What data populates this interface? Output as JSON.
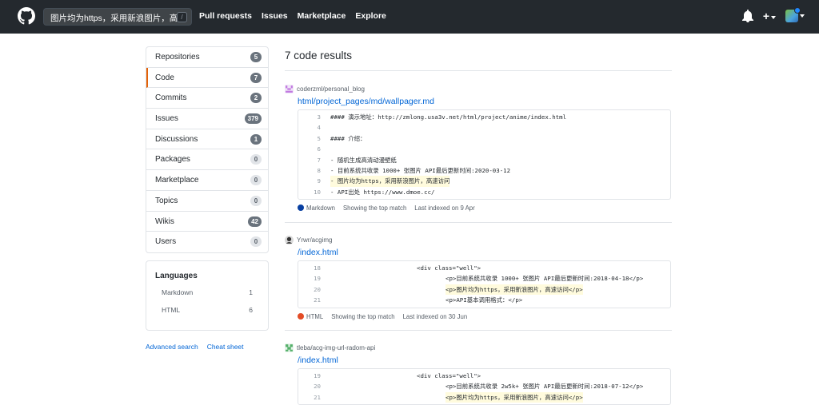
{
  "header": {
    "search_value": "图片均为https，采用新浪图片，高速",
    "search_shortcut": "/",
    "nav": [
      "Pull requests",
      "Issues",
      "Marketplace",
      "Explore"
    ],
    "plus_label": "+"
  },
  "sidebar": {
    "items": [
      {
        "label": "Repositories",
        "count": "5"
      },
      {
        "label": "Code",
        "count": "7"
      },
      {
        "label": "Commits",
        "count": "2"
      },
      {
        "label": "Issues",
        "count": "379"
      },
      {
        "label": "Discussions",
        "count": "1"
      },
      {
        "label": "Packages",
        "count": "0"
      },
      {
        "label": "Marketplace",
        "count": "0"
      },
      {
        "label": "Topics",
        "count": "0"
      },
      {
        "label": "Wikis",
        "count": "42"
      },
      {
        "label": "Users",
        "count": "0"
      }
    ],
    "languages": {
      "title": "Languages",
      "items": [
        {
          "name": "Markdown",
          "count": "1"
        },
        {
          "name": "HTML",
          "count": "6"
        }
      ]
    },
    "links": {
      "advanced": "Advanced search",
      "cheat": "Cheat sheet"
    }
  },
  "results": {
    "title": "7 code results",
    "items": [
      {
        "repo": "coderzml/personal_blog",
        "file": "html/project_pages/md/wallpager.md",
        "lines": [
          {
            "n": "3",
            "text": "#### 演示地址：http://zmlong.usa3v.net/html/project/anime/index.html"
          },
          {
            "n": "4",
            "text": ""
          },
          {
            "n": "5",
            "text": "#### 介绍："
          },
          {
            "n": "6",
            "text": ""
          },
          {
            "n": "7",
            "text": "- 随机生成高清动漫壁纸"
          },
          {
            "n": "8",
            "text": "- 目前系统共收录 1000+ 张图片 API最后更新时间:2020-03-12"
          },
          {
            "n": "9",
            "text": "- 图片均为https，采用新浪图片，高速访问"
          },
          {
            "n": "10",
            "text": "- API出处 https://www.dmoe.cc/"
          }
        ],
        "language": "Markdown",
        "lang_color": "#083fa1",
        "match": "Showing the top match",
        "indexed": "Last indexed on 9 Apr"
      },
      {
        "repo": "Yrwr/acgimg",
        "file": "/index.html",
        "lines": [
          {
            "n": "18",
            "text": "<div class=\"well\">"
          },
          {
            "n": "19",
            "text": "<p>目前系统共收录 1000+ 张图片 API最后更新时间:2018-04-18</p>"
          },
          {
            "n": "20",
            "text": "<p>图片均为https，采用新浪图片，高速访问</p>"
          },
          {
            "n": "21",
            "text": "<p>API基本调用格式：</p>"
          }
        ],
        "language": "HTML",
        "lang_color": "#e34c26",
        "match": "Showing the top match",
        "indexed": "Last indexed on 30 Jun"
      },
      {
        "repo": "tleba/acg-img-url-radom-api",
        "file": "/index.html",
        "lines": [
          {
            "n": "19",
            "text": "<div class=\"well\">"
          },
          {
            "n": "20",
            "text": "<p>目前系统共收录 2w5k+ 张图片 API最后更新时间:2018-07-12</p>"
          },
          {
            "n": "21",
            "text": "<p>图片均为https，采用新浪图片，高速访问</p>"
          }
        ]
      }
    ]
  },
  "colors": {
    "header_bg": "#24292e",
    "link": "#0366d6",
    "selected_accent": "#e36209",
    "highlight": "#fffbdd"
  }
}
